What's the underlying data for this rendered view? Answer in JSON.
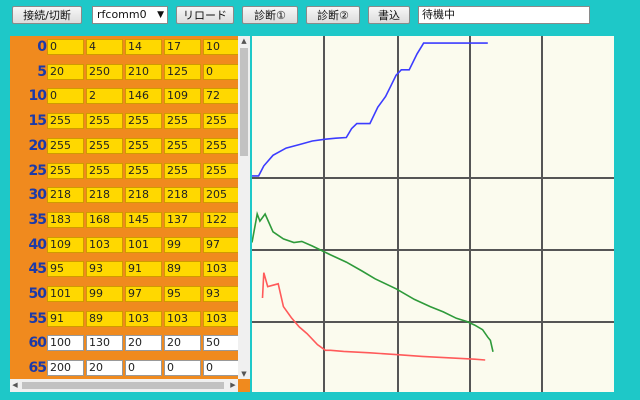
{
  "toolbar": {
    "connect_label": "接続/切断",
    "port_value": "rfcomm0",
    "reload_label": "リロード",
    "diag1_label": "診断①",
    "diag2_label": "診断②",
    "write_label": "書込",
    "status_text": "待機中"
  },
  "table": {
    "rows": [
      {
        "label": "0",
        "cells": [
          "0",
          "4",
          "14",
          "17",
          "10"
        ],
        "style": "yellow"
      },
      {
        "label": "5",
        "cells": [
          "20",
          "250",
          "210",
          "125",
          "0"
        ],
        "style": "yellow"
      },
      {
        "label": "10",
        "cells": [
          "0",
          "2",
          "146",
          "109",
          "72"
        ],
        "style": "yellow"
      },
      {
        "label": "15",
        "cells": [
          "255",
          "255",
          "255",
          "255",
          "255"
        ],
        "style": "yellow"
      },
      {
        "label": "20",
        "cells": [
          "255",
          "255",
          "255",
          "255",
          "255"
        ],
        "style": "yellow"
      },
      {
        "label": "25",
        "cells": [
          "255",
          "255",
          "255",
          "255",
          "255"
        ],
        "style": "yellow"
      },
      {
        "label": "30",
        "cells": [
          "218",
          "218",
          "218",
          "218",
          "205"
        ],
        "style": "yellow"
      },
      {
        "label": "35",
        "cells": [
          "183",
          "168",
          "145",
          "137",
          "122"
        ],
        "style": "yellow"
      },
      {
        "label": "40",
        "cells": [
          "109",
          "103",
          "101",
          "99",
          "97"
        ],
        "style": "yellow"
      },
      {
        "label": "45",
        "cells": [
          "95",
          "93",
          "91",
          "89",
          "103"
        ],
        "style": "yellow"
      },
      {
        "label": "50",
        "cells": [
          "101",
          "99",
          "97",
          "95",
          "93"
        ],
        "style": "yellow"
      },
      {
        "label": "55",
        "cells": [
          "91",
          "89",
          "103",
          "103",
          "103"
        ],
        "style": "yellow"
      },
      {
        "label": "60",
        "cells": [
          "100",
          "130",
          "20",
          "20",
          "50"
        ],
        "style": "white"
      },
      {
        "label": "65",
        "cells": [
          "200",
          "20",
          "0",
          "0",
          "0"
        ],
        "style": "white"
      }
    ]
  },
  "chart_data": {
    "type": "line",
    "title": "",
    "xlabel": "",
    "ylabel": "",
    "background": "#fbfbee",
    "grid": true,
    "grid_color": "#555555",
    "xlim": [
      0,
      100
    ],
    "ylim": [
      0,
      100
    ],
    "series": [
      {
        "color": "#3c3cff",
        "points": [
          [
            0,
            60.7
          ],
          [
            2.5,
            60.7
          ],
          [
            4.5,
            63.5
          ],
          [
            8,
            66.5
          ],
          [
            13,
            68.5
          ],
          [
            18,
            69.5
          ],
          [
            23,
            70.5
          ],
          [
            28,
            71
          ],
          [
            32,
            71.3
          ],
          [
            36,
            71.5
          ],
          [
            38,
            74
          ],
          [
            40,
            75.4
          ],
          [
            45,
            75.4
          ],
          [
            48,
            80
          ],
          [
            51,
            83
          ],
          [
            53,
            86
          ],
          [
            55,
            89
          ],
          [
            57,
            90.5
          ],
          [
            60,
            90.5
          ],
          [
            63,
            95
          ],
          [
            65,
            97.4
          ],
          [
            65.5,
            98
          ],
          [
            72,
            98
          ],
          [
            90,
            98
          ]
        ]
      },
      {
        "color": "#2e9a3a",
        "points": [
          [
            0,
            42
          ],
          [
            2,
            50
          ],
          [
            3,
            48
          ],
          [
            5,
            50
          ],
          [
            8,
            45
          ],
          [
            12,
            43
          ],
          [
            16,
            42
          ],
          [
            19,
            42.3
          ],
          [
            23,
            41
          ],
          [
            30,
            38.5
          ],
          [
            36,
            36.5
          ],
          [
            42,
            34
          ],
          [
            47,
            31.8
          ],
          [
            55,
            29
          ],
          [
            62,
            26
          ],
          [
            68,
            24
          ],
          [
            73,
            22.5
          ],
          [
            78,
            20.7
          ],
          [
            82,
            19.8
          ],
          [
            85,
            18.8
          ],
          [
            88,
            17.5
          ],
          [
            90,
            15.4
          ],
          [
            91,
            14.5
          ],
          [
            92,
            11.3
          ]
        ]
      },
      {
        "color": "#ff5a5a",
        "points": [
          [
            4,
            26.4
          ],
          [
            4.5,
            33.5
          ],
          [
            6,
            29.6
          ],
          [
            8,
            30
          ],
          [
            10,
            30.4
          ],
          [
            12,
            24
          ],
          [
            15,
            20.9
          ],
          [
            18,
            18.3
          ],
          [
            21,
            16.4
          ],
          [
            25,
            13.3
          ],
          [
            28,
            11.7
          ],
          [
            30,
            11.7
          ],
          [
            35,
            11.4
          ],
          [
            45,
            11
          ],
          [
            55,
            10.5
          ],
          [
            65,
            10
          ],
          [
            75,
            9.6
          ],
          [
            85,
            9.2
          ],
          [
            89,
            9
          ]
        ]
      }
    ]
  }
}
